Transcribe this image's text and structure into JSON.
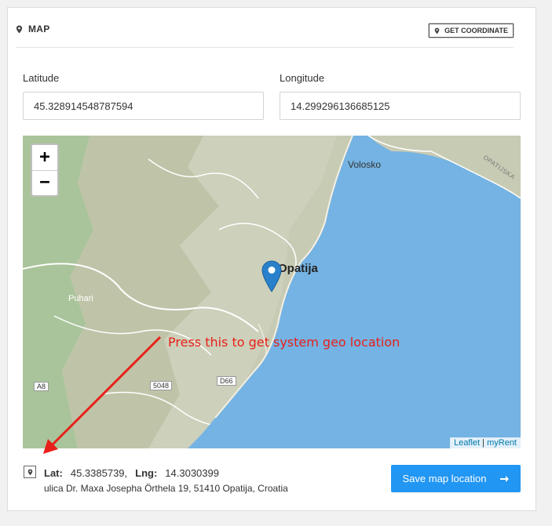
{
  "header": {
    "title": "MAP",
    "get_coordinate_label": "GET COORDINATE"
  },
  "form": {
    "latitude_label": "Latitude",
    "latitude_value": "45.328914548787594",
    "longitude_label": "Longitude",
    "longitude_value": "14.299296136685125"
  },
  "map": {
    "zoom_in": "+",
    "zoom_out": "−",
    "places": [
      "Volosko",
      "Opatija",
      "Puhari",
      "OPATIJSKA"
    ],
    "roads": [
      "A8",
      "5048",
      "D66"
    ],
    "attribution_leaflet": "Leaflet",
    "attribution_sep": " | ",
    "attribution_provider": "myRent",
    "sea_color": "#74b3e3",
    "marker_color": "#2a81cb"
  },
  "annotation": {
    "text": "Press this to get system geo location",
    "color": "#e8201a"
  },
  "footer": {
    "lat_label": "Lat:",
    "lat_value": "45.3385739,",
    "lng_label": "Lng:",
    "lng_value": "14.3030399",
    "address": "ulica Dr. Maxa Josepha Örthela 19, 51410 Opatija, Croatia",
    "save_label": "Save map location"
  },
  "colors": {
    "accent": "#2196f3"
  }
}
